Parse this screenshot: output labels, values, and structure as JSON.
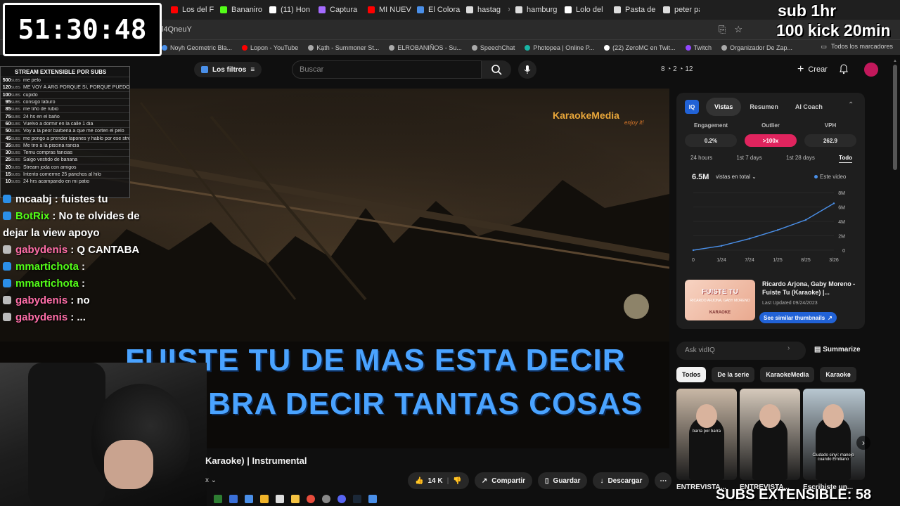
{
  "tabs": [
    {
      "label": "Los del F",
      "color": "#ff0000"
    },
    {
      "label": "Bananiro",
      "color": "#53fc18"
    },
    {
      "label": "(11) Hon",
      "color": "#ffffff"
    },
    {
      "label": "Captura",
      "color": "#a56bff"
    },
    {
      "label": "MI NUEV",
      "color": "#ff0000"
    },
    {
      "label": "El Colora",
      "color": "#4a8fe8"
    },
    {
      "label": "hastag",
      "color": "#dddddd"
    },
    {
      "label": "hamburg",
      "color": "#dddddd"
    },
    {
      "label": "Lolo del",
      "color": "#ffffff"
    },
    {
      "label": "Pasta de",
      "color": "#dddddd"
    },
    {
      "label": "peter pa",
      "color": "#dddddd"
    }
  ],
  "address": "l4QneuY",
  "bookmarks": [
    {
      "label": "Noyh Geometric Bla...",
      "color": "#4a8fe8"
    },
    {
      "label": "Lopon - YouTube",
      "color": "#ff0000"
    },
    {
      "label": "Kạth - Summoner St...",
      "color": "#aaaaaa"
    },
    {
      "label": "ELROBANIÑOS - Su...",
      "color": "#aaaaaa"
    },
    {
      "label": "SpeechChat",
      "color": "#aaaaaa"
    },
    {
      "label": "Photopea | Online P...",
      "color": "#19b5a5"
    },
    {
      "label": "(22) ZeroMC en Twit...",
      "color": "#ffffff"
    },
    {
      "label": "Twitch",
      "color": "#9147ff"
    },
    {
      "label": "Organizador De Zap...",
      "color": "#aaaaaa"
    }
  ],
  "bookmarks_all": "Todos los marcadores",
  "youtube": {
    "filters_label": "Los filtros",
    "search_placeholder": "Buscar",
    "stat_icons": "8 ◔ 2 ◔ 12",
    "create_label": "Crear"
  },
  "overlay": {
    "timer": "51:30:48",
    "sub_hr": "sub 1hr",
    "kick": "100 kick 20min",
    "subs_extensible": "SUBS EXTENSIBLE: 58",
    "subs_table_title": "STREAM EXTENSIBLE POR SUBS",
    "subs_unit": "SUBS",
    "subs_rows": [
      {
        "amount": "500",
        "text": "me pelo"
      },
      {
        "amount": "120",
        "text": "ME VOY A ARG PORQUE SI, PORQUE PUEDO"
      },
      {
        "amount": "100",
        "text": "cupido"
      },
      {
        "amount": "95",
        "text": "consigo laburo"
      },
      {
        "amount": "85",
        "text": "me tiño de rubio"
      },
      {
        "amount": "75",
        "text": "24 hs en el baño"
      },
      {
        "amount": "60",
        "text": "Vuelvo a dormir en la calle 1 dia"
      },
      {
        "amount": "50",
        "text": "Voy a la peor barberia a que me corten el pelo"
      },
      {
        "amount": "45",
        "text": "me pongo a prender lapones y hablo por ese stream lapones"
      },
      {
        "amount": "35",
        "text": "Me tiro a la piscina rancia"
      },
      {
        "amount": "30",
        "text": "Temu compras fancias"
      },
      {
        "amount": "25",
        "text": "Salgo vestido de banana"
      },
      {
        "amount": "20",
        "text": "Stream joda con amigos"
      },
      {
        "amount": "15",
        "text": "Intento comerme 25 panchos al hilo"
      },
      {
        "amount": "10",
        "text": "24 hrs acampando en mi patio"
      }
    ]
  },
  "chat": [
    {
      "user": "mcaabj",
      "message": "fuistes tu",
      "user_color": "#ffffff",
      "icon": "#2b8fe8"
    },
    {
      "user": "BotRix",
      "message": "No te olvides de dejar la view apoyo",
      "user_color": "#53fc18",
      "icon": "#2b8fe8"
    },
    {
      "user": "gabydenis",
      "message": "Q CANTABA",
      "user_color": "#ff6ea8",
      "icon": "#bbbbbb"
    },
    {
      "user": "mmartichota",
      "message": "",
      "user_color": "#53fc18",
      "icon": "#2b8fe8"
    },
    {
      "user": "mmartichota",
      "message": "",
      "user_color": "#53fc18",
      "icon": "#2b8fe8"
    },
    {
      "user": "gabydenis",
      "message": "no",
      "user_color": "#ff6ea8",
      "icon": "#bbbbbb"
    },
    {
      "user": "gabydenis",
      "message": "...",
      "user_color": "#ff6ea8",
      "icon": "#bbbbbb"
    }
  ],
  "video": {
    "brand": "KaraokeMedia",
    "brand_tag": "enjoy it!",
    "lyric_line1": "FUISTE TU DE MAS ESTA DECIR",
    "lyric_line2": "BRA DECIR TANTAS COSAS",
    "title": "Karaoke) | Instrumental",
    "channel_fragment": "x",
    "likes": "14 K",
    "share_label": "Compartir",
    "save_label": "Guardar",
    "download_label": "Descargar"
  },
  "panel": {
    "iq_label": "IQ",
    "tabs": [
      "Vistas",
      "Resumen",
      "AI Coach"
    ],
    "metrics": [
      {
        "label": "Engagement",
        "value": "0.2%"
      },
      {
        "label": "Outlier",
        "value": ">100x"
      },
      {
        "label": "VPH",
        "value": "262.9"
      }
    ],
    "periods": [
      "24 hours",
      "1st 7 days",
      "1st 28 days",
      "Todo"
    ],
    "views_total": "6.5M",
    "views_mode": "vistas en total",
    "series_label": "Este video",
    "related_title": "Ricardo Arjona, Gaby Moreno - Fuiste Tu (Karaoke) |...",
    "related_date": "Last Updated 09/24/2023",
    "similar_label": "See similar thumbnails",
    "thumb_title": "FUISTE TU",
    "thumb_sub": "RICARDO ARJONA, GABY MORENO",
    "thumb_tag": "KARAOKE"
  },
  "chart_data": {
    "type": "line",
    "x": [
      "0",
      "1/24",
      "7/24",
      "1/25",
      "8/25",
      "3/26"
    ],
    "y_ticks": [
      "0",
      "2M",
      "4M",
      "6M",
      "8M"
    ],
    "ylim": [
      0,
      8
    ],
    "series": [
      {
        "name": "Este video",
        "values": [
          0,
          0.6,
          1.6,
          2.8,
          4.2,
          6.5
        ]
      }
    ]
  },
  "ask": {
    "placeholder": "Ask vidIQ",
    "summarize": "Summarize"
  },
  "chips": [
    "Todos",
    "De la serie",
    "KaraokeMedia",
    "Karaoke"
  ],
  "thumbs": [
    {
      "label": "ENTREVISTA...",
      "color": "#c9b8a6",
      "caption": "barra por barra"
    },
    {
      "label": "ENTREVISTA...",
      "color": "#d6cabc",
      "caption": ""
    },
    {
      "label": "Escribiste un...",
      "color": "#b8c7d1",
      "caption": "Ciudado sinyi: manejo cuando Emiliano"
    }
  ]
}
